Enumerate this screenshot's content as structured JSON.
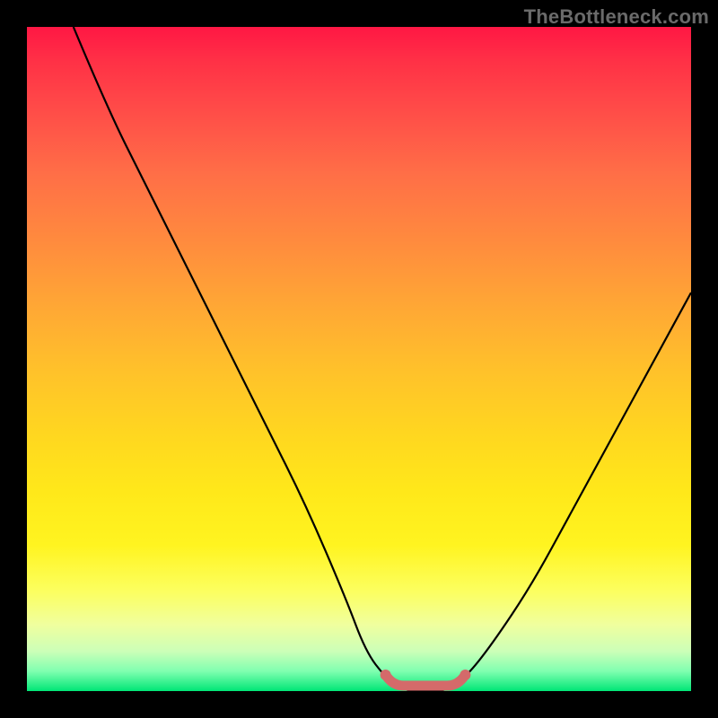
{
  "watermark": "TheBottleneck.com",
  "colors": {
    "background": "#000000",
    "gradient_top": "#ff1744",
    "gradient_mid": "#ffd81f",
    "gradient_bottom": "#00e676",
    "curve": "#000000",
    "highlight": "#d46a6a"
  },
  "chart_data": {
    "type": "line",
    "title": "",
    "xlabel": "",
    "ylabel": "",
    "xlim": [
      0,
      100
    ],
    "ylim": [
      0,
      100
    ],
    "series": [
      {
        "name": "bottleneck-curve",
        "x": [
          7,
          12,
          18,
          24,
          30,
          36,
          42,
          48,
          51,
          54,
          57,
          60,
          63,
          66,
          70,
          76,
          82,
          88,
          94,
          100
        ],
        "values": [
          100,
          88,
          76,
          64,
          52,
          40,
          28,
          14,
          6,
          2,
          0,
          0,
          0,
          2,
          7,
          16,
          27,
          38,
          49,
          60
        ]
      }
    ],
    "annotations": [
      {
        "name": "minimum-highlight",
        "x_range": [
          54,
          66
        ],
        "y": 0,
        "color": "#d46a6a"
      }
    ]
  }
}
